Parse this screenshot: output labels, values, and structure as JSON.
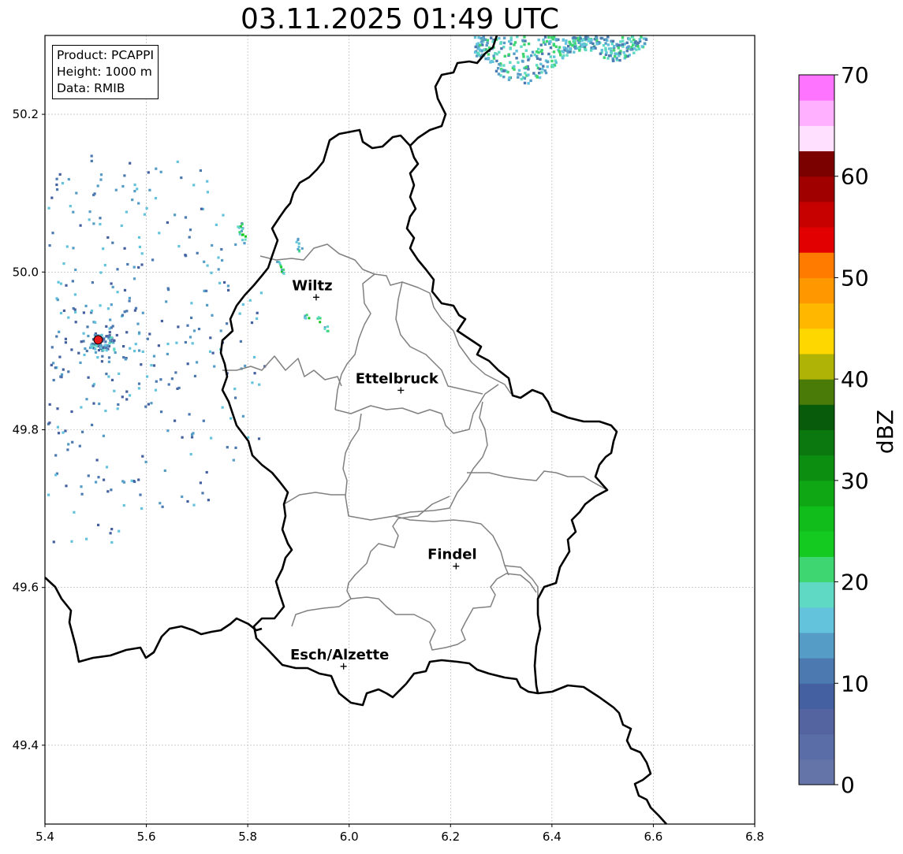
{
  "title": "03.11.2025 01:49 UTC",
  "info": {
    "product": "Product: PCAPPI",
    "height": "Height: 1000 m",
    "data": "Data: RMIB"
  },
  "axes": {
    "x_ticks": [
      "5.4",
      "5.6",
      "5.8",
      "6.0",
      "6.2",
      "6.4",
      "6.6",
      "6.8"
    ],
    "y_ticks": [
      "49.4",
      "49.6",
      "49.8",
      "50.0",
      "50.2"
    ],
    "lon_range": [
      5.4,
      6.8
    ],
    "lat_range": [
      49.3,
      50.3
    ],
    "grid": true
  },
  "colorbar": {
    "label": "dBZ",
    "ticks": [
      "0",
      "10",
      "20",
      "30",
      "40",
      "50",
      "60",
      "70"
    ],
    "range": [
      0,
      70
    ],
    "step": 2.5,
    "colors": [
      "#6574a8",
      "#5a6da6",
      "#5364a0",
      "#4560a0",
      "#4b79b0",
      "#559dc6",
      "#64c3dc",
      "#5fd9c4",
      "#3dd670",
      "#14c91f",
      "#11bd1a",
      "#0fa714",
      "#0c8f11",
      "#0a780e",
      "#075b0b",
      "#4a7a07",
      "#afb306",
      "#ffd700",
      "#ffb700",
      "#ff9800",
      "#ff7b00",
      "#e30000",
      "#c70000",
      "#a00000",
      "#7b0000",
      "#ffe0ff",
      "#ffb0ff",
      "#ff74ff",
      "#ed35ed"
    ]
  },
  "cities": [
    {
      "name": "Wiltz",
      "lon": 5.935,
      "lat": 49.968
    },
    {
      "name": "Ettelbruck",
      "lon": 6.102,
      "lat": 49.85
    },
    {
      "name": "Findel",
      "lon": 6.211,
      "lat": 49.627
    },
    {
      "name": "Esch/Alzette",
      "lon": 5.989,
      "lat": 49.5
    }
  ],
  "radar_site": {
    "lon": 5.505,
    "lat": 49.914,
    "color": "#e8191d"
  }
}
